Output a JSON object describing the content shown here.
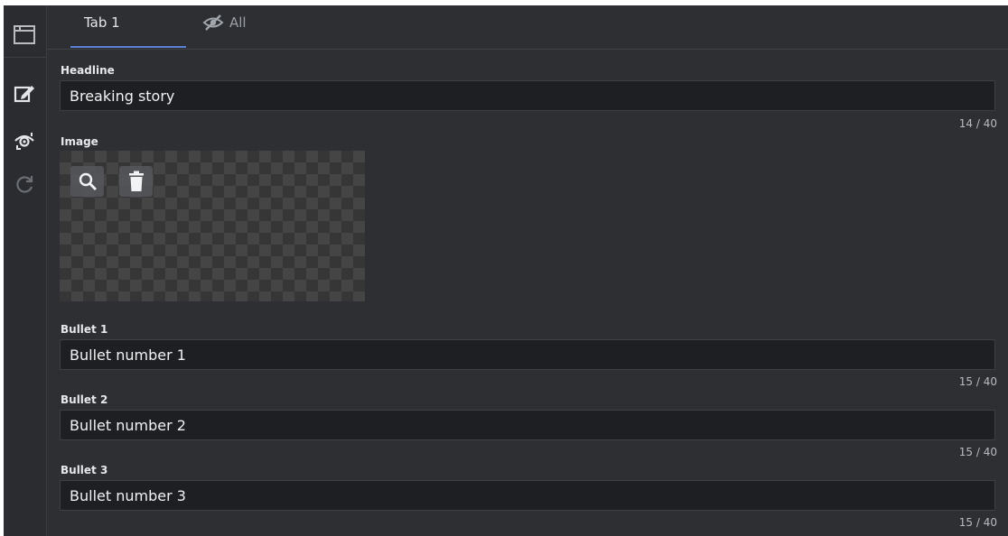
{
  "sidebar": {
    "icons": [
      {
        "name": "folder-icon"
      },
      {
        "name": "edit-icon"
      },
      {
        "name": "preview-icon"
      },
      {
        "name": "refresh-icon"
      }
    ]
  },
  "tabs": [
    {
      "label": "Tab 1",
      "active": true
    },
    {
      "label": "All",
      "icon": "hidden-eye-icon",
      "active": false
    }
  ],
  "fields": {
    "headline": {
      "label": "Headline",
      "value": "Breaking story",
      "counter": "14 / 40"
    },
    "image": {
      "label": "Image",
      "actions": [
        "search-icon",
        "delete-icon"
      ]
    },
    "bullet1": {
      "label": "Bullet 1",
      "value": "Bullet number 1",
      "counter": "15 / 40"
    },
    "bullet2": {
      "label": "Bullet 2",
      "value": "Bullet number 2",
      "counter": "15 / 40"
    },
    "bullet3": {
      "label": "Bullet 3",
      "value": "Bullet number 3",
      "counter": "15 / 40"
    }
  },
  "colors": {
    "background": "#2d2f33",
    "input_background": "#1d1f22",
    "accent": "#5b7ed6"
  }
}
